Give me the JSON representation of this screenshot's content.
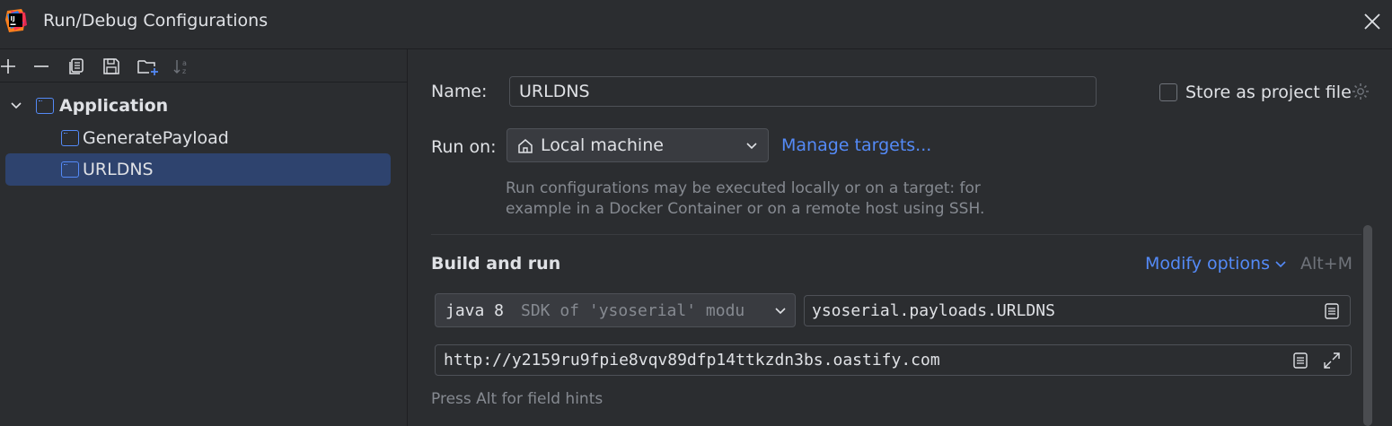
{
  "window": {
    "title": "Run/Debug Configurations",
    "logo_text": "IJ"
  },
  "toolbar": {
    "add": "add-icon",
    "remove": "remove-icon",
    "copy": "copy-icon",
    "save": "save-icon",
    "new_folder": "new-folder-icon",
    "sort": "sort-alphabetically-icon"
  },
  "tree": {
    "group_label": "Application",
    "items": [
      {
        "label": "GeneratePayload",
        "selected": false
      },
      {
        "label": "URLDNS",
        "selected": true
      }
    ]
  },
  "form": {
    "name_label": "Name:",
    "name_value": "URLDNS",
    "store_label": "Store as project file",
    "store_checked": false,
    "run_on_label": "Run on:",
    "run_on_value": "Local machine",
    "manage_targets": "Manage targets...",
    "run_on_hint_line1": "Run configurations may be executed locally or on a target: for",
    "run_on_hint_line2": "example in a Docker Container or on a remote host using SSH.",
    "section_title": "Build and run",
    "modify_options": "Modify options",
    "modify_shortcut": "Alt+M",
    "jdk_primary": "java 8",
    "jdk_secondary": "SDK of 'ysoserial' modu",
    "main_class": "ysoserial.payloads.URLDNS",
    "program_args": "http://y2159ru9fpie8vqv89dfp14ttkzdn3bs.oastify.com",
    "field_hint": "Press Alt for field hints"
  },
  "colors": {
    "background": "#2b2d30",
    "accent": "#548af7",
    "selection": "#2e436e",
    "hint": "#868a91"
  }
}
